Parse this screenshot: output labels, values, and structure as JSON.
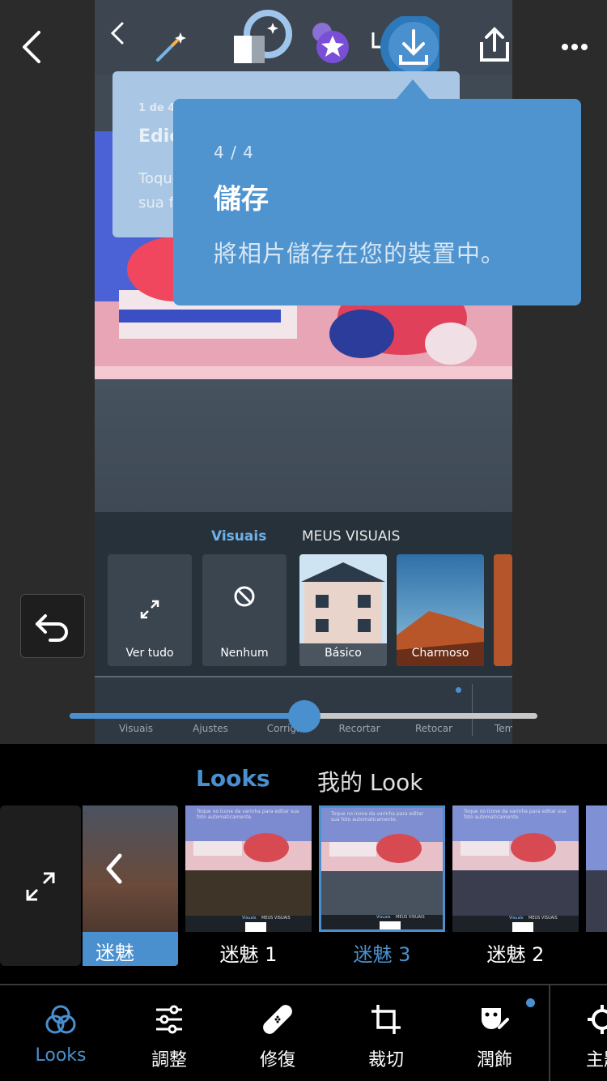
{
  "app": {
    "accent": "#4a90cf"
  },
  "inner_screenshot": {
    "tooltip_back": {
      "step": "1 de 4",
      "title": "Edição",
      "body": "Toque sua fo"
    },
    "look_tabs": {
      "active": "Visuais",
      "other": "MEUS VISUAIS"
    },
    "look_cards": [
      "Ver tudo",
      "Nenhum",
      "Básico",
      "Charmoso"
    ],
    "nav": [
      "Visuais",
      "Ajustes",
      "Corrigir",
      "Recortar",
      "Retocar",
      "Tem"
    ]
  },
  "tooltip": {
    "step": "4 / 4",
    "title": "儲存",
    "body": "將相片儲存在您的裝置中。"
  },
  "slider": {
    "value": 0.5
  },
  "looks": {
    "tabs": {
      "active": "Looks",
      "other": "我的 Look"
    },
    "selected_label": "迷魅",
    "thumbs": [
      {
        "label": "迷魅 1",
        "selected": false
      },
      {
        "label": "迷魅 3",
        "selected": true
      },
      {
        "label": "迷魅 2",
        "selected": false
      }
    ],
    "thumb_caption": "Toque no ícone da varinha para editar sua foto automaticamente.",
    "thumb_tabs": [
      "Visuais",
      "MEUS VISUAIS"
    ]
  },
  "bottom_nav": [
    {
      "label": "Looks",
      "icon": "looks-icon",
      "active": true
    },
    {
      "label": "調整",
      "icon": "sliders-icon",
      "active": false
    },
    {
      "label": "修復",
      "icon": "bandage-icon",
      "active": false
    },
    {
      "label": "裁切",
      "icon": "crop-icon",
      "active": false
    },
    {
      "label": "潤飾",
      "icon": "face-brush-icon",
      "active": false,
      "badge": true
    },
    {
      "label": "主題",
      "icon": "gear-theme-icon",
      "active": false
    }
  ]
}
